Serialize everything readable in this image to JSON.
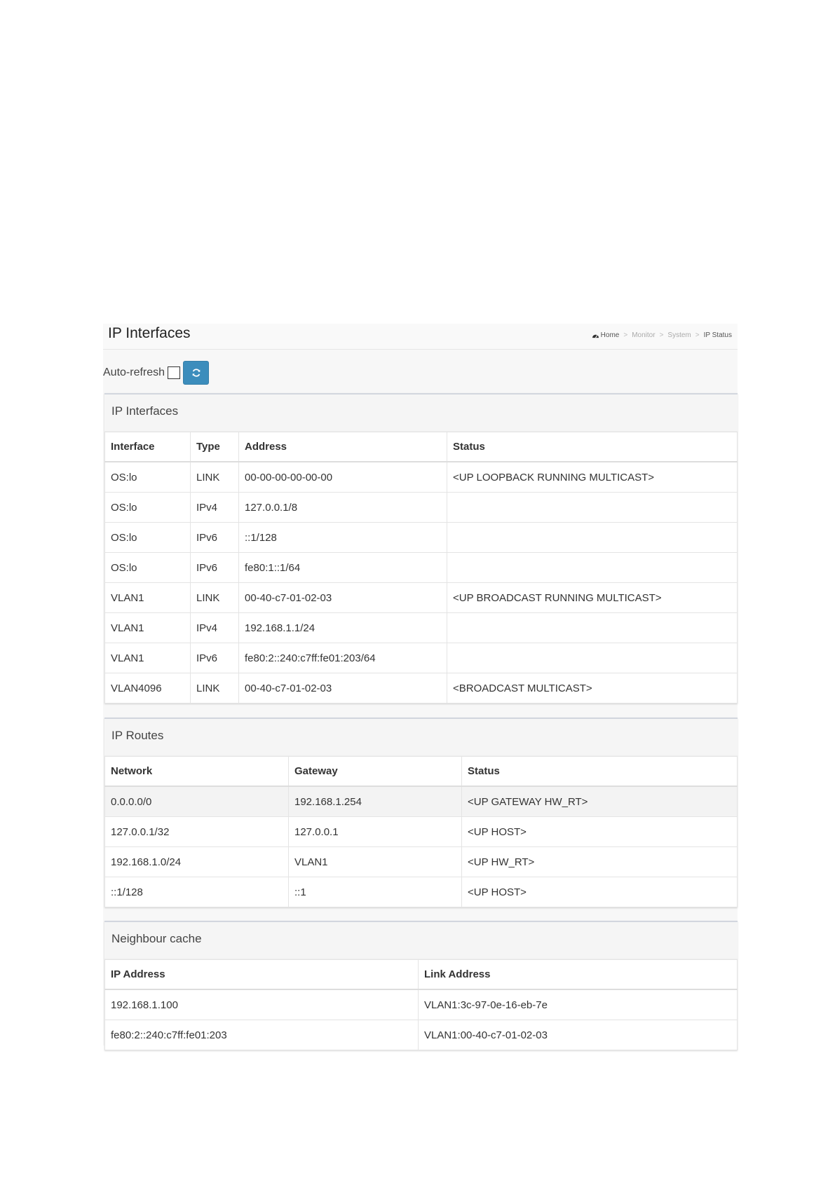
{
  "page": {
    "title": "IP Interfaces",
    "breadcrumb": {
      "home": "Home",
      "items": [
        "Monitor",
        "System",
        "IP Status"
      ],
      "separator": ">"
    },
    "auto_refresh_label": "Auto-refresh",
    "auto_refresh_checked": false,
    "refresh_icon": "refresh-icon",
    "accent_color": "#3c8dbc"
  },
  "ip_interfaces": {
    "title": "IP Interfaces",
    "columns": [
      "Interface",
      "Type",
      "Address",
      "Status"
    ],
    "rows": [
      [
        "OS:lo",
        "LINK",
        "00-00-00-00-00-00",
        "<UP LOOPBACK RUNNING MULTICAST>"
      ],
      [
        "OS:lo",
        "IPv4",
        "127.0.0.1/8",
        ""
      ],
      [
        "OS:lo",
        "IPv6",
        "::1/128",
        ""
      ],
      [
        "OS:lo",
        "IPv6",
        "fe80:1::1/64",
        ""
      ],
      [
        "VLAN1",
        "LINK",
        "00-40-c7-01-02-03",
        "<UP BROADCAST RUNNING MULTICAST>"
      ],
      [
        "VLAN1",
        "IPv4",
        "192.168.1.1/24",
        ""
      ],
      [
        "VLAN1",
        "IPv6",
        "fe80:2::240:c7ff:fe01:203/64",
        ""
      ],
      [
        "VLAN4096",
        "LINK",
        "00-40-c7-01-02-03",
        "<BROADCAST MULTICAST>"
      ]
    ]
  },
  "ip_routes": {
    "title": "IP Routes",
    "columns": [
      "Network",
      "Gateway",
      "Status"
    ],
    "rows": [
      [
        "0.0.0.0/0",
        "192.168.1.254",
        "<UP GATEWAY HW_RT>"
      ],
      [
        "127.0.0.1/32",
        "127.0.0.1",
        "<UP HOST>"
      ],
      [
        "192.168.1.0/24",
        "VLAN1",
        "<UP HW_RT>"
      ],
      [
        "::1/128",
        "::1",
        "<UP HOST>"
      ]
    ]
  },
  "neighbour_cache": {
    "title": "Neighbour cache",
    "columns": [
      "IP Address",
      "Link Address"
    ],
    "rows": [
      [
        "192.168.1.100",
        "VLAN1:3c-97-0e-16-eb-7e"
      ],
      [
        "fe80:2::240:c7ff:fe01:203",
        "VLAN1:00-40-c7-01-02-03"
      ]
    ]
  }
}
